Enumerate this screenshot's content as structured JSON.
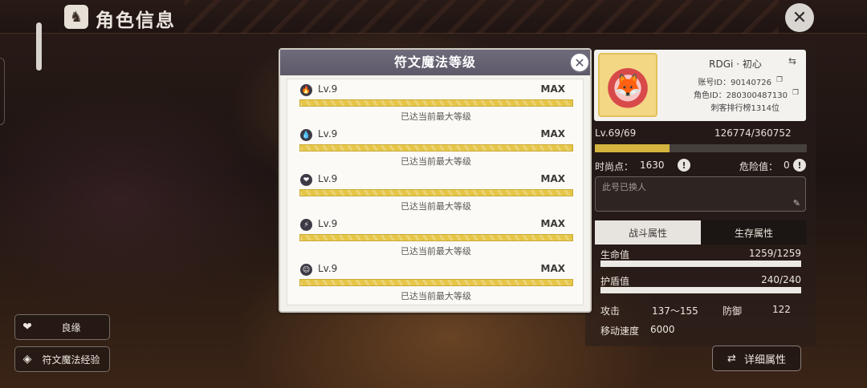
{
  "header": {
    "title": "角色信息"
  },
  "modal": {
    "title": "符文魔法等级",
    "runes": [
      {
        "icon": "flame-icon",
        "glyph": "🔥",
        "level": "Lv.9",
        "max": "MAX",
        "progress": 1.0,
        "note": "已达当前最大等级"
      },
      {
        "icon": "drop-icon",
        "glyph": "💧",
        "level": "Lv.9",
        "max": "MAX",
        "progress": 1.0,
        "note": "已达当前最大等级"
      },
      {
        "icon": "heart-icon",
        "glyph": "❤",
        "level": "Lv.9",
        "max": "MAX",
        "progress": 1.0,
        "note": "已达当前最大等级"
      },
      {
        "icon": "lightning-icon",
        "glyph": "⚡",
        "level": "Lv.9",
        "max": "MAX",
        "progress": 1.0,
        "note": "已达当前最大等级"
      },
      {
        "icon": "smiley-icon",
        "glyph": "☺",
        "level": "Lv.9",
        "max": "MAX",
        "progress": 1.0,
        "note": "已达当前最大等级"
      }
    ]
  },
  "sidebar": {
    "buttons": [
      {
        "label": "良缘",
        "icon": "hearts-icon"
      },
      {
        "label": "符文魔法经验",
        "icon": "rune-icon"
      }
    ]
  },
  "profile": {
    "name": "RDGi · 初心",
    "account_id": "账号ID：90140726",
    "role_id": "角色ID：280300487130",
    "rank": "刺客排行榜1314位",
    "level": "Lv.69/69",
    "xp": "126774/360752",
    "xp_ratio": 0.351,
    "fashion_label": "时尚点：",
    "fashion_value": "1630",
    "danger_label": "危险值：",
    "danger_value": "0",
    "note_placeholder": "此号已换人"
  },
  "tabs": [
    "战斗属性",
    "生存属性"
  ],
  "attributes": {
    "hp_label": "生命值",
    "hp_value": "1259/1259",
    "hp_ratio": 1.0,
    "shield_label": "护盾值",
    "shield_value": "240/240",
    "shield_ratio": 1.0,
    "attack_label": "攻击",
    "attack_value": "137～155",
    "defense_label": "防御",
    "defense_value": "122",
    "speed_label": "移动速度",
    "speed_value": "6000"
  },
  "detail_button": "详细属性"
}
